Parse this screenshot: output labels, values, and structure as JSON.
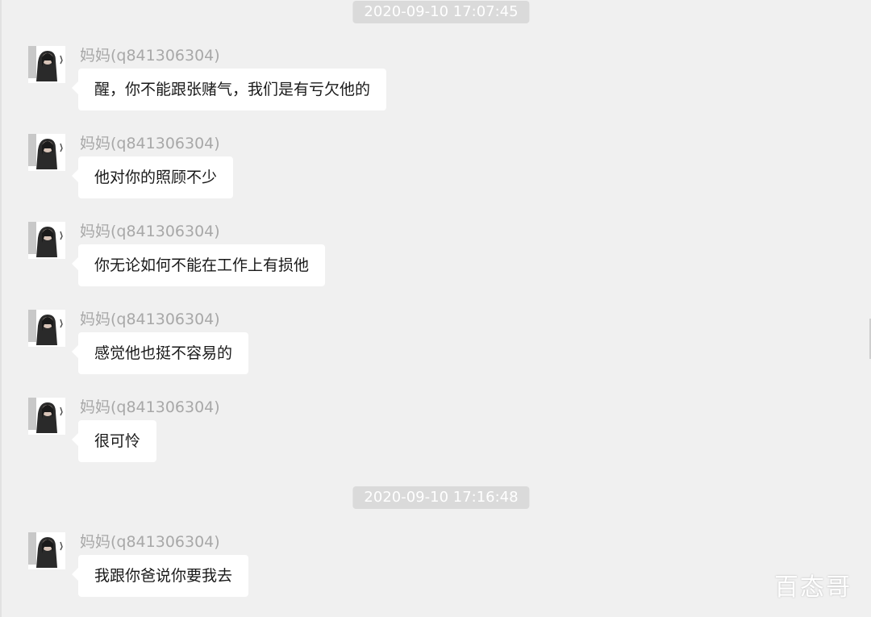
{
  "chat": {
    "timestamps": [
      "2020-09-10 17:07:45",
      "2020-09-10 17:16:48"
    ],
    "messages": [
      {
        "sender": "妈妈(q841306304)",
        "text": "醒，你不能跟张赌气，我们是有亏欠他的",
        "avatar_icon": "user-avatar-photo"
      },
      {
        "sender": "妈妈(q841306304)",
        "text": "他对你的照顾不少",
        "avatar_icon": "user-avatar-photo"
      },
      {
        "sender": "妈妈(q841306304)",
        "text": "你无论如何不能在工作上有损他",
        "avatar_icon": "user-avatar-photo"
      },
      {
        "sender": "妈妈(q841306304)",
        "text": "感觉他也挺不容易的",
        "avatar_icon": "user-avatar-photo"
      },
      {
        "sender": "妈妈(q841306304)",
        "text": "很可怜",
        "avatar_icon": "user-avatar-photo"
      },
      {
        "sender": "妈妈(q841306304)",
        "text": "我跟你爸说你要我去",
        "avatar_icon": "user-avatar-photo"
      }
    ]
  },
  "watermark": "百态哥",
  "colors": {
    "background": "#f0f0f0",
    "bubble": "#ffffff",
    "timestamp_bg": "#dadada",
    "sender_text": "#a8a8a8",
    "message_text": "#191919"
  }
}
